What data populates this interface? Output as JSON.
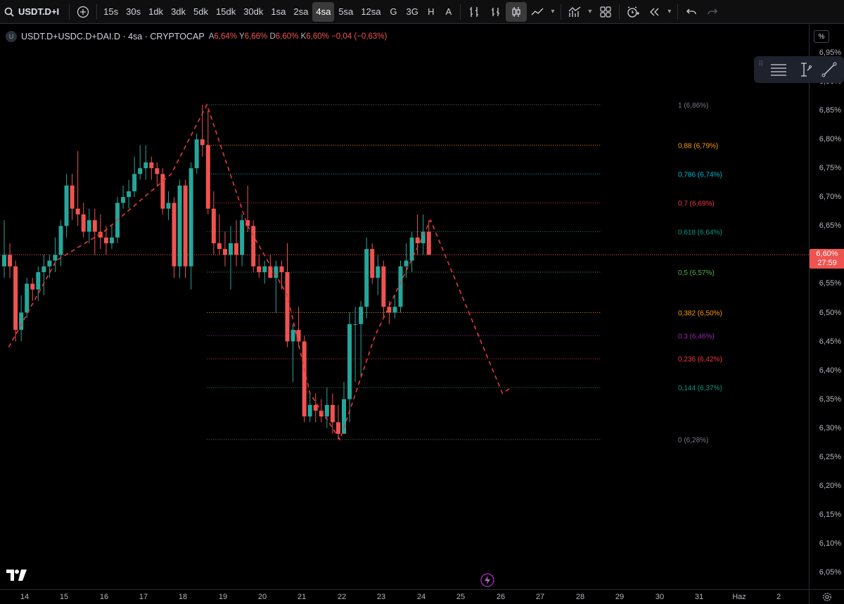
{
  "toolbar": {
    "symbol": "USDT.D+I",
    "intervals": [
      "15s",
      "30s",
      "1dk",
      "3dk",
      "5dk",
      "15dk",
      "30dk",
      "1sa",
      "2sa",
      "4sa",
      "5sa",
      "12sa",
      "G",
      "3G",
      "H",
      "A"
    ],
    "active_interval": "4sa"
  },
  "legend": {
    "badge": "U",
    "title": "USDT.D+USDC.D+DAI.D · 4sa · CRYPTOCAP",
    "o_key": "A",
    "o_val": "6,64%",
    "h_key": "Y",
    "h_val": "6,66%",
    "l_key": "D",
    "l_val": "6,60%",
    "c_key": "K",
    "c_val": "6,60%",
    "change": "−0,04 (−0,63%)"
  },
  "price_axis": {
    "unit_button": "%",
    "labels": [
      "6,95%",
      "6,90%",
      "6,85%",
      "6,80%",
      "6,75%",
      "6,70%",
      "6,65%",
      "6,60%",
      "6,55%",
      "6,50%",
      "6,45%",
      "6,40%",
      "6,35%",
      "6,30%",
      "6,25%",
      "6,20%",
      "6,15%",
      "6,10%",
      "6,05%"
    ],
    "current_price": "6,60%",
    "countdown": "27:59"
  },
  "time_axis": {
    "labels": [
      "14",
      "15",
      "16",
      "17",
      "18",
      "19",
      "20",
      "21",
      "22",
      "23",
      "24",
      "25",
      "26",
      "27",
      "28",
      "29",
      "30",
      "31",
      "Haz",
      "2"
    ]
  },
  "fib_levels": [
    {
      "label": "1 (6,86%)",
      "price": 6.86,
      "color": "#787b86"
    },
    {
      "label": "0,88 (6,79%)",
      "price": 6.79,
      "color": "#ff9800"
    },
    {
      "label": "0,786 (6,74%)",
      "price": 6.74,
      "color": "#00bcd4"
    },
    {
      "label": "0,7 (6,69%)",
      "price": 6.69,
      "color": "#f23645"
    },
    {
      "label": "0,618 (6,64%)",
      "price": 6.64,
      "color": "#089981"
    },
    {
      "label": "0,5 (6,57%)",
      "price": 6.57,
      "color": "#4caf50"
    },
    {
      "label": "0,382 (6,50%)",
      "price": 6.5,
      "color": "#ff9800"
    },
    {
      "label": "0,3 (6,46%)",
      "price": 6.46,
      "color": "#9c27b0"
    },
    {
      "label": "0,236 (6,42%)",
      "price": 6.42,
      "color": "#f23645"
    },
    {
      "label": "0,144 (6,37%)",
      "price": 6.37,
      "color": "#089981"
    },
    {
      "label": "0 (6,28%)",
      "price": 6.28,
      "color": "#787b86"
    }
  ],
  "colors": {
    "up": "#26a69a",
    "down": "#ef5350",
    "drawing": "#e53935",
    "background": "#000000"
  },
  "chart_data": {
    "type": "candlestick",
    "symbol": "USDT.D+USDC.D+DAI.D",
    "interval": "4sa",
    "ylim": [
      6.02,
      6.97
    ],
    "x_dates": [
      "14",
      "15",
      "16",
      "17",
      "18",
      "19",
      "20",
      "21",
      "22",
      "23",
      "24",
      "25",
      "26",
      "27",
      "28",
      "29",
      "30",
      "31",
      "Haz",
      "2"
    ],
    "candles": [
      {
        "o": 6.58,
        "h": 6.66,
        "l": 6.56,
        "c": 6.6
      },
      {
        "o": 6.6,
        "h": 6.62,
        "l": 6.56,
        "c": 6.58
      },
      {
        "o": 6.58,
        "h": 6.59,
        "l": 6.45,
        "c": 6.47
      },
      {
        "o": 6.47,
        "h": 6.53,
        "l": 6.45,
        "c": 6.5
      },
      {
        "o": 6.5,
        "h": 6.56,
        "l": 6.49,
        "c": 6.55
      },
      {
        "o": 6.55,
        "h": 6.56,
        "l": 6.52,
        "c": 6.54
      },
      {
        "o": 6.54,
        "h": 6.58,
        "l": 6.52,
        "c": 6.57
      },
      {
        "o": 6.57,
        "h": 6.6,
        "l": 6.53,
        "c": 6.58
      },
      {
        "o": 6.58,
        "h": 6.6,
        "l": 6.56,
        "c": 6.59
      },
      {
        "o": 6.59,
        "h": 6.63,
        "l": 6.57,
        "c": 6.6
      },
      {
        "o": 6.6,
        "h": 6.66,
        "l": 6.58,
        "c": 6.65
      },
      {
        "o": 6.65,
        "h": 6.74,
        "l": 6.63,
        "c": 6.72
      },
      {
        "o": 6.72,
        "h": 6.74,
        "l": 6.66,
        "c": 6.68
      },
      {
        "o": 6.68,
        "h": 6.78,
        "l": 6.65,
        "c": 6.67
      },
      {
        "o": 6.67,
        "h": 6.69,
        "l": 6.63,
        "c": 6.64
      },
      {
        "o": 6.64,
        "h": 6.68,
        "l": 6.62,
        "c": 6.66
      },
      {
        "o": 6.66,
        "h": 6.68,
        "l": 6.6,
        "c": 6.64
      },
      {
        "o": 6.64,
        "h": 6.67,
        "l": 6.61,
        "c": 6.63
      },
      {
        "o": 6.63,
        "h": 6.65,
        "l": 6.6,
        "c": 6.62
      },
      {
        "o": 6.62,
        "h": 6.65,
        "l": 6.61,
        "c": 6.63
      },
      {
        "o": 6.63,
        "h": 6.7,
        "l": 6.62,
        "c": 6.69
      },
      {
        "o": 6.69,
        "h": 6.72,
        "l": 6.68,
        "c": 6.7
      },
      {
        "o": 6.7,
        "h": 6.73,
        "l": 6.68,
        "c": 6.71
      },
      {
        "o": 6.71,
        "h": 6.77,
        "l": 6.7,
        "c": 6.74
      },
      {
        "o": 6.74,
        "h": 6.79,
        "l": 6.73,
        "c": 6.75
      },
      {
        "o": 6.75,
        "h": 6.79,
        "l": 6.73,
        "c": 6.76
      },
      {
        "o": 6.76,
        "h": 6.77,
        "l": 6.73,
        "c": 6.75
      },
      {
        "o": 6.75,
        "h": 6.76,
        "l": 6.72,
        "c": 6.74
      },
      {
        "o": 6.74,
        "h": 6.75,
        "l": 6.67,
        "c": 6.68
      },
      {
        "o": 6.68,
        "h": 6.71,
        "l": 6.66,
        "c": 6.69
      },
      {
        "o": 6.69,
        "h": 6.7,
        "l": 6.56,
        "c": 6.58
      },
      {
        "o": 6.58,
        "h": 6.73,
        "l": 6.56,
        "c": 6.72
      },
      {
        "o": 6.72,
        "h": 6.73,
        "l": 6.56,
        "c": 6.58
      },
      {
        "o": 6.58,
        "h": 6.76,
        "l": 6.54,
        "c": 6.75
      },
      {
        "o": 6.75,
        "h": 6.81,
        "l": 6.74,
        "c": 6.8
      },
      {
        "o": 6.8,
        "h": 6.86,
        "l": 6.77,
        "c": 6.79
      },
      {
        "o": 6.79,
        "h": 6.85,
        "l": 6.67,
        "c": 6.68
      },
      {
        "o": 6.68,
        "h": 6.71,
        "l": 6.6,
        "c": 6.62
      },
      {
        "o": 6.62,
        "h": 6.67,
        "l": 6.6,
        "c": 6.61
      },
      {
        "o": 6.61,
        "h": 6.64,
        "l": 6.58,
        "c": 6.6
      },
      {
        "o": 6.6,
        "h": 6.65,
        "l": 6.54,
        "c": 6.62
      },
      {
        "o": 6.62,
        "h": 6.66,
        "l": 6.58,
        "c": 6.6
      },
      {
        "o": 6.6,
        "h": 6.67,
        "l": 6.58,
        "c": 6.66
      },
      {
        "o": 6.66,
        "h": 6.72,
        "l": 6.64,
        "c": 6.65
      },
      {
        "o": 6.65,
        "h": 6.66,
        "l": 6.57,
        "c": 6.58
      },
      {
        "o": 6.58,
        "h": 6.6,
        "l": 6.56,
        "c": 6.57
      },
      {
        "o": 6.57,
        "h": 6.59,
        "l": 6.55,
        "c": 6.58
      },
      {
        "o": 6.58,
        "h": 6.6,
        "l": 6.56,
        "c": 6.56
      },
      {
        "o": 6.56,
        "h": 6.59,
        "l": 6.5,
        "c": 6.58
      },
      {
        "o": 6.58,
        "h": 6.59,
        "l": 6.54,
        "c": 6.57
      },
      {
        "o": 6.57,
        "h": 6.62,
        "l": 6.44,
        "c": 6.45
      },
      {
        "o": 6.45,
        "h": 6.48,
        "l": 6.38,
        "c": 6.47
      },
      {
        "o": 6.47,
        "h": 6.51,
        "l": 6.44,
        "c": 6.45
      },
      {
        "o": 6.45,
        "h": 6.46,
        "l": 6.31,
        "c": 6.32
      },
      {
        "o": 6.32,
        "h": 6.36,
        "l": 6.31,
        "c": 6.34
      },
      {
        "o": 6.34,
        "h": 6.36,
        "l": 6.31,
        "c": 6.33
      },
      {
        "o": 6.33,
        "h": 6.35,
        "l": 6.31,
        "c": 6.32
      },
      {
        "o": 6.32,
        "h": 6.37,
        "l": 6.3,
        "c": 6.34
      },
      {
        "o": 6.34,
        "h": 6.36,
        "l": 6.29,
        "c": 6.31
      },
      {
        "o": 6.31,
        "h": 6.34,
        "l": 6.28,
        "c": 6.29
      },
      {
        "o": 6.29,
        "h": 6.38,
        "l": 6.29,
        "c": 6.35
      },
      {
        "o": 6.35,
        "h": 6.5,
        "l": 6.31,
        "c": 6.48
      },
      {
        "o": 6.48,
        "h": 6.51,
        "l": 6.38,
        "c": 6.48
      },
      {
        "o": 6.48,
        "h": 6.52,
        "l": 6.39,
        "c": 6.51
      },
      {
        "o": 6.51,
        "h": 6.63,
        "l": 6.49,
        "c": 6.61
      },
      {
        "o": 6.61,
        "h": 6.62,
        "l": 6.55,
        "c": 6.56
      },
      {
        "o": 6.56,
        "h": 6.6,
        "l": 6.53,
        "c": 6.58
      },
      {
        "o": 6.58,
        "h": 6.59,
        "l": 6.49,
        "c": 6.51
      },
      {
        "o": 6.51,
        "h": 6.52,
        "l": 6.48,
        "c": 6.5
      },
      {
        "o": 6.5,
        "h": 6.53,
        "l": 6.49,
        "c": 6.51
      },
      {
        "o": 6.51,
        "h": 6.59,
        "l": 6.5,
        "c": 6.58
      },
      {
        "o": 6.58,
        "h": 6.62,
        "l": 6.56,
        "c": 6.59
      },
      {
        "o": 6.59,
        "h": 6.64,
        "l": 6.57,
        "c": 6.63
      },
      {
        "o": 6.63,
        "h": 6.67,
        "l": 6.6,
        "c": 6.62
      },
      {
        "o": 6.62,
        "h": 6.67,
        "l": 6.6,
        "c": 6.64
      },
      {
        "o": 6.64,
        "h": 6.66,
        "l": 6.6,
        "c": 6.6
      }
    ],
    "projection_path": [
      {
        "idx": 0.8,
        "price": 6.44
      },
      {
        "idx": 9.2,
        "price": 6.59
      },
      {
        "idx": 17.6,
        "price": 6.64
      },
      {
        "idx": 29.5,
        "price": 6.74
      },
      {
        "idx": 35.8,
        "price": 6.86
      },
      {
        "idx": 43,
        "price": 6.65
      },
      {
        "idx": 50,
        "price": 6.53
      },
      {
        "idx": 54,
        "price": 6.36
      },
      {
        "idx": 59.3,
        "price": 6.28
      },
      {
        "idx": 65.5,
        "price": 6.46
      },
      {
        "idx": 75.3,
        "price": 6.66
      },
      {
        "idx": 88,
        "price": 6.36
      },
      {
        "idx": 89.5,
        "price": 6.37
      }
    ],
    "fib_start_idx": 35.8,
    "fib_end_idx": 105.5
  }
}
